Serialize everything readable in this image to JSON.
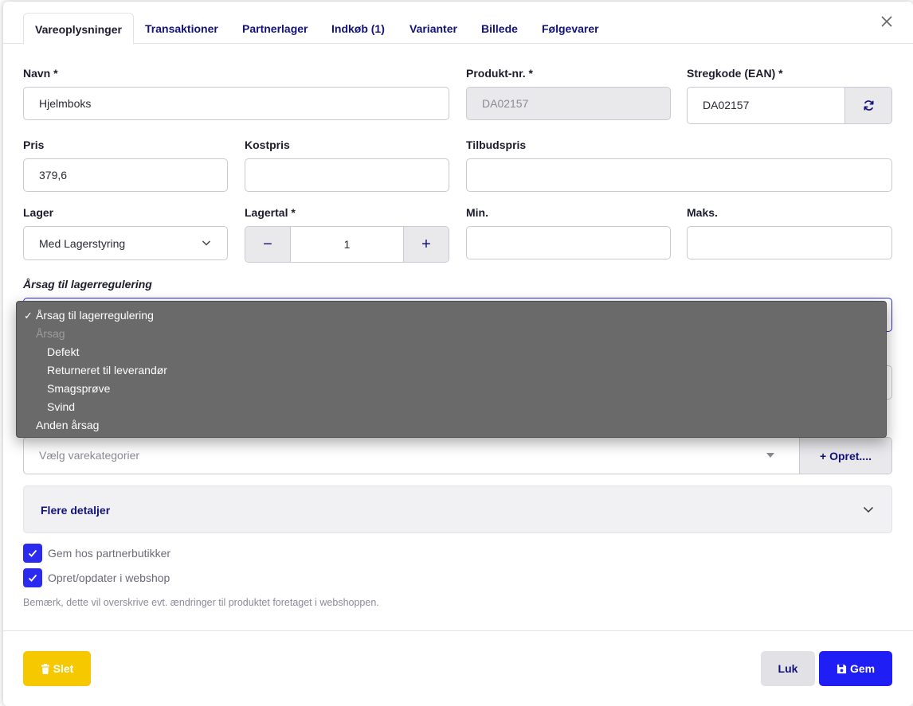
{
  "tabs": [
    {
      "label": "Vareoplysninger"
    },
    {
      "label": "Transaktioner"
    },
    {
      "label": "Partnerlager"
    },
    {
      "label": "Indkøb (1)"
    },
    {
      "label": "Varianter"
    },
    {
      "label": "Billede"
    },
    {
      "label": "Følgevarer"
    }
  ],
  "fields": {
    "name": {
      "label": "Navn *",
      "value": "Hjelmboks"
    },
    "product_no": {
      "label": "Produkt-nr. *",
      "value": "DA02157"
    },
    "barcode": {
      "label": "Stregkode (EAN) *",
      "value": "DA02157"
    },
    "price": {
      "label": "Pris",
      "value": "379,6"
    },
    "cost_price": {
      "label": "Kostpris",
      "value": ""
    },
    "offer_price": {
      "label": "Tilbudspris",
      "value": ""
    },
    "stock": {
      "label": "Lager",
      "value": "Med Lagerstyring"
    },
    "stock_count": {
      "label": "Lagertal *",
      "value": "1",
      "minus": "−",
      "plus": "+"
    },
    "min": {
      "label": "Min.",
      "value": ""
    },
    "max": {
      "label": "Maks.",
      "value": ""
    },
    "reason": {
      "label": "Årsag til lagerregulering"
    }
  },
  "dropdown": {
    "selected_mark": "✓",
    "selected": "Årsag til lagerregulering",
    "group_label": "Årsag",
    "group_options": [
      "Defekt",
      "Returneret til leverandør",
      "Smagsprøve",
      "Svind"
    ],
    "other": "Anden årsag"
  },
  "categories": {
    "placeholder": "Vælg varekategorier",
    "create_label": "+ Opret...."
  },
  "details": {
    "title": "Flere detaljer"
  },
  "checkboxes": [
    {
      "label": "Gem hos partnerbutikker",
      "checked": true
    },
    {
      "label": "Opret/opdater i webshop",
      "checked": true
    }
  ],
  "note": "Bemærk, dette vil overskrive evt. ændringer til produktet foretaget i webshoppen.",
  "buttons": {
    "delete": "Slet",
    "close": "Luk",
    "save": "Gem"
  },
  "colors": {
    "primary": "#1e1ef5",
    "delete": "#f5c800",
    "tab_text": "#12127a"
  }
}
